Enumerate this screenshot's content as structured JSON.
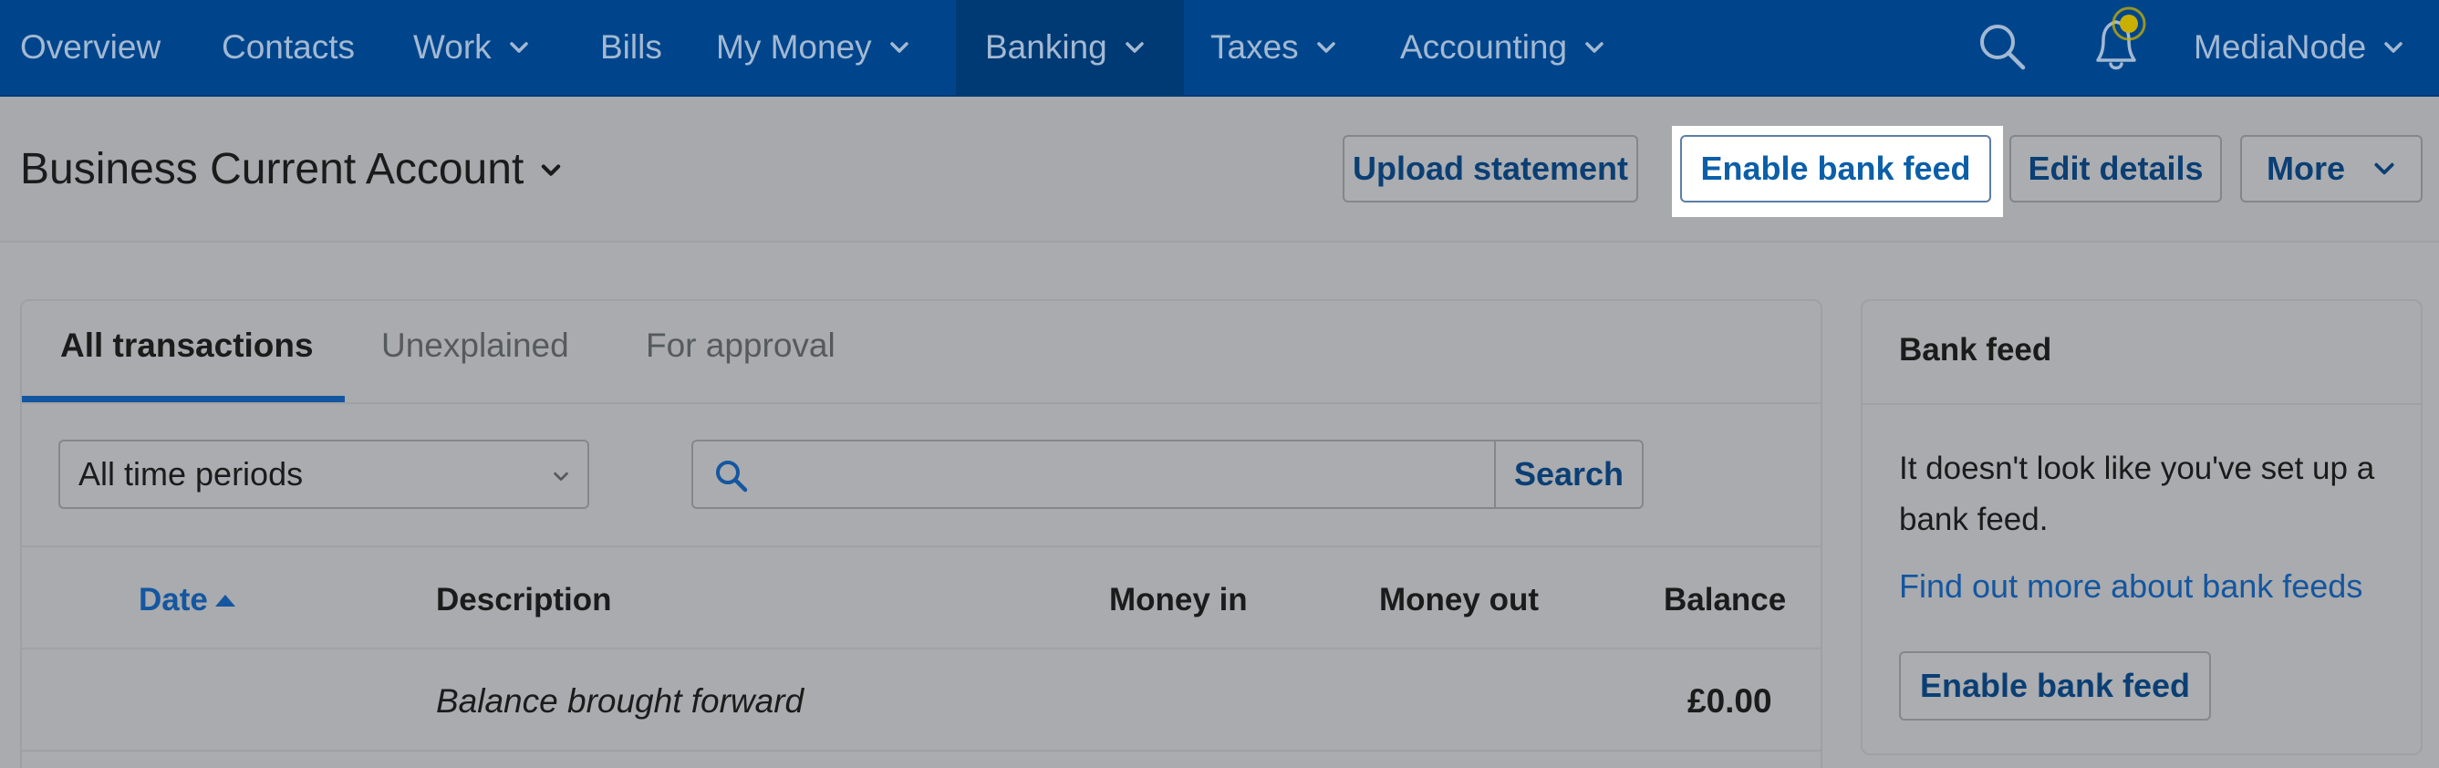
{
  "nav": {
    "items": [
      {
        "label": "Overview",
        "has_dropdown": false
      },
      {
        "label": "Contacts",
        "has_dropdown": false
      },
      {
        "label": "Work",
        "has_dropdown": true
      },
      {
        "label": "Bills",
        "has_dropdown": false
      },
      {
        "label": "My Money",
        "has_dropdown": true
      },
      {
        "label": "Banking",
        "has_dropdown": true,
        "active": true
      },
      {
        "label": "Taxes",
        "has_dropdown": true
      },
      {
        "label": "Accounting",
        "has_dropdown": true
      }
    ],
    "account_name": "MediaNode",
    "icons": [
      "search-icon",
      "notification-bell-icon"
    ]
  },
  "header": {
    "title": "Business Current Account",
    "buttons": {
      "upload": "Upload statement",
      "enable_feed": "Enable bank feed",
      "edit": "Edit details",
      "more": "More"
    }
  },
  "transactions": {
    "tabs": [
      "All transactions",
      "Unexplained",
      "For approval"
    ],
    "active_tab": "All transactions",
    "period_select": "All time periods",
    "search": {
      "placeholder": "",
      "button": "Search"
    },
    "columns": {
      "date": "Date",
      "description": "Description",
      "money_in": "Money in",
      "money_out": "Money out",
      "balance": "Balance"
    },
    "rows": [
      {
        "date": "",
        "description": "Balance brought forward",
        "money_in": "",
        "money_out": "",
        "balance": "£0.00"
      }
    ]
  },
  "bank_feed": {
    "title": "Bank feed",
    "message": "It doesn't look like you've set up a bank feed.",
    "link": "Find out more about bank feeds",
    "button": "Enable bank feed"
  },
  "colors": {
    "nav_bg": "#00458c",
    "accent_blue": "#1456a0",
    "notification_dot": "#c9b000"
  }
}
